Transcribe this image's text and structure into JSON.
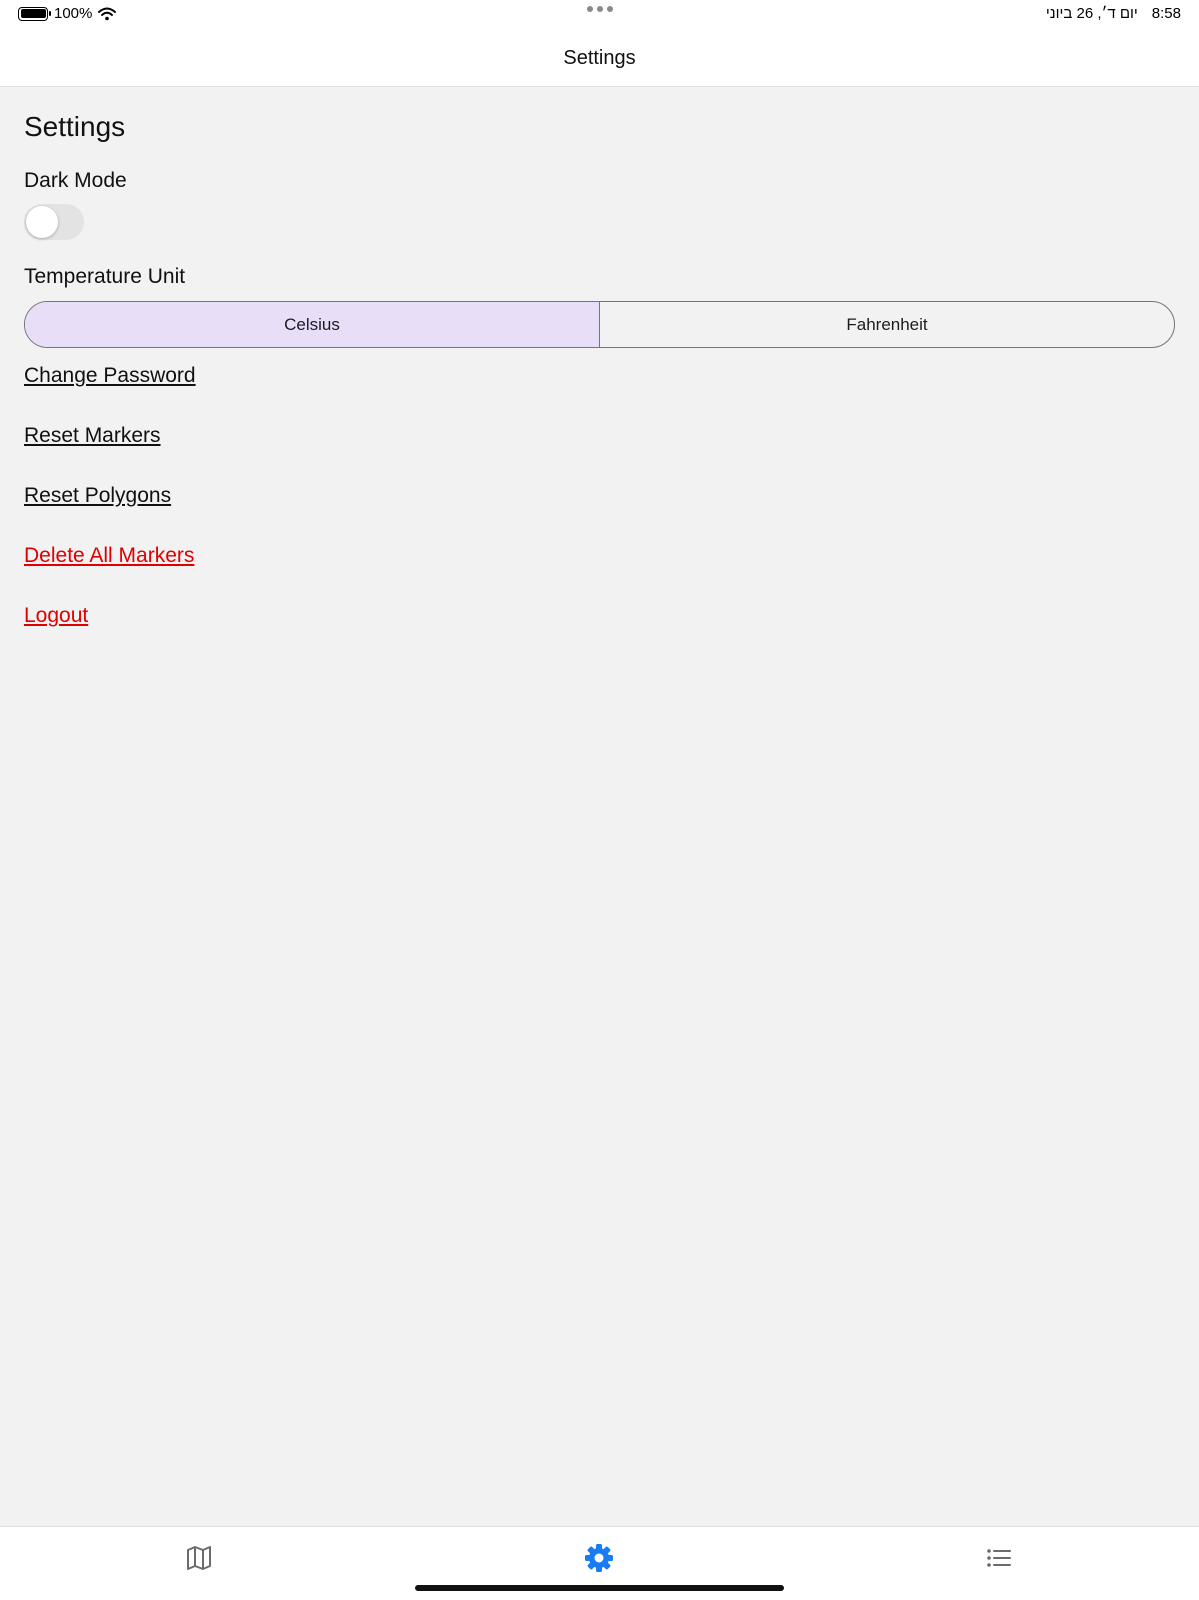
{
  "status_bar": {
    "battery": "100%",
    "date": "יום ד׳, 26 ביוני",
    "time": "8:58"
  },
  "nav_bar": {
    "title": "Settings"
  },
  "settings": {
    "title": "Settings",
    "dark_mode": {
      "label": "Dark Mode",
      "enabled": false
    },
    "temperature_unit": {
      "label": "Temperature Unit",
      "options": [
        "Celsius",
        "Fahrenheit"
      ],
      "selected": "Celsius"
    },
    "actions": {
      "change_password": "Change Password",
      "reset_markers": "Reset Markers",
      "reset_polygons": "Reset Polygons",
      "delete_all_markers": "Delete All Markers",
      "logout": "Logout"
    }
  },
  "tab_bar": {
    "tabs": [
      {
        "icon": "map-icon",
        "active": false
      },
      {
        "icon": "gear-icon",
        "active": true
      },
      {
        "icon": "list-icon",
        "active": false
      }
    ],
    "active_color": "#1a7cf5",
    "inactive_color": "#6b6b6b"
  },
  "colors": {
    "danger": "#e00000",
    "segment_selected": "#e8def8",
    "background": "#f2f2f2"
  }
}
